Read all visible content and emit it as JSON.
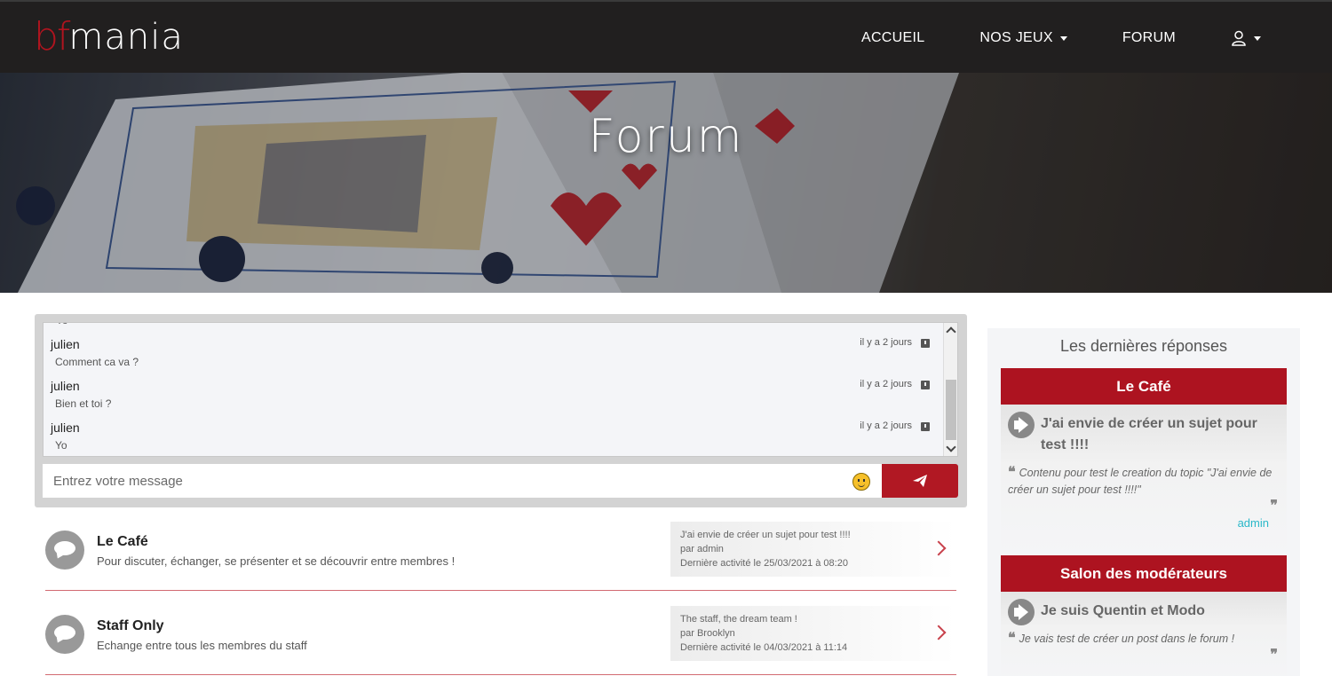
{
  "navbar": {
    "logo_bf": "bf",
    "logo_mania": "mania",
    "items": [
      {
        "label": "ACCUEIL"
      },
      {
        "label": "NOS JEUX"
      },
      {
        "label": "FORUM"
      }
    ]
  },
  "hero": {
    "title": "Forum"
  },
  "chat": {
    "messages": [
      {
        "user": "julien",
        "text": "Comment ca va ?",
        "time": "il y a 2 jours"
      },
      {
        "user": "julien",
        "text": "Bien et toi ?",
        "time": "il y a 2 jours"
      },
      {
        "user": "julien",
        "text": "Yo",
        "time": "il y a 2 jours"
      }
    ],
    "partial_text": "Yo",
    "input_placeholder": "Entrez votre message"
  },
  "categories": [
    {
      "title": "Le Café",
      "description": "Pour discuter, échanger, se présenter et se découvrir entre membres !",
      "last_topic": "J'ai envie de créer un sujet pour test !!!!",
      "last_author": "par admin",
      "last_activity": "Dernière activité le 25/03/2021 à 08:20"
    },
    {
      "title": "Staff Only",
      "description": "Echange entre tous les membres du staff",
      "last_topic": "The staff, the dream team !",
      "last_author": "par Brooklyn",
      "last_activity": "Dernière activité le 04/03/2021 à 11:14"
    }
  ],
  "sidebar": {
    "title": "Les dernières réponses",
    "cards": [
      {
        "forum": "Le Café",
        "topic": "J'ai envie de créer un sujet pour test !!!!",
        "quote": "Contenu pour test le creation du topic \"J'ai envie de créer un sujet pour test !!!!\"",
        "author": "admin"
      },
      {
        "forum": "Salon des modérateurs",
        "topic": "Je suis Quentin et Modo",
        "quote": "Je vais test de créer un post dans le forum !",
        "author": ""
      }
    ]
  },
  "colors": {
    "brand_red": "#b11823",
    "nav_bg": "#211f1f",
    "link_cyan": "#2ab8c9"
  }
}
